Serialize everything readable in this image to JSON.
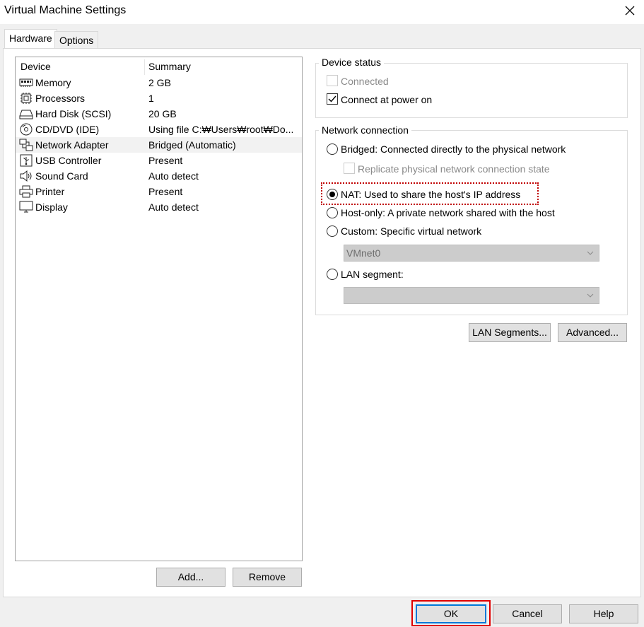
{
  "window": {
    "title": "Virtual Machine Settings"
  },
  "tabs": [
    {
      "label": "Hardware",
      "active": true
    },
    {
      "label": "Options",
      "active": false
    }
  ],
  "device_list": {
    "columns": [
      "Device",
      "Summary"
    ],
    "rows": [
      {
        "name": "Memory",
        "summary": "2 GB",
        "icon": "memory-icon"
      },
      {
        "name": "Processors",
        "summary": "1",
        "icon": "processor-icon"
      },
      {
        "name": "Hard Disk (SCSI)",
        "summary": "20 GB",
        "icon": "hard-disk-icon"
      },
      {
        "name": "CD/DVD (IDE)",
        "summary": "Using file C:₩Users₩root₩Do...",
        "icon": "cd-dvd-icon"
      },
      {
        "name": "Network Adapter",
        "summary": "Bridged (Automatic)",
        "icon": "network-adapter-icon",
        "selected": true
      },
      {
        "name": "USB Controller",
        "summary": "Present",
        "icon": "usb-icon"
      },
      {
        "name": "Sound Card",
        "summary": "Auto detect",
        "icon": "speaker-icon"
      },
      {
        "name": "Printer",
        "summary": "Present",
        "icon": "printer-icon"
      },
      {
        "name": "Display",
        "summary": "Auto detect",
        "icon": "monitor-icon"
      }
    ],
    "add_label": "Add...",
    "remove_label": "Remove"
  },
  "device_status": {
    "title": "Device status",
    "connected_label": "Connected",
    "connected_checked": false,
    "power_on_label": "Connect at power on",
    "power_on_checked": true
  },
  "network": {
    "title": "Network connection",
    "bridged_label": "Bridged: Connected directly to the physical network",
    "replicate_label": "Replicate physical network connection state",
    "nat_label": "NAT: Used to share the host's IP address",
    "hostonly_label": "Host-only: A private network shared with the host",
    "custom_label": "Custom: Specific virtual network",
    "custom_value": "VMnet0",
    "lan_label": "LAN segment:",
    "lan_value": "",
    "selected": "nat"
  },
  "buttons": {
    "lan_segments": "LAN Segments...",
    "advanced": "Advanced...",
    "ok": "OK",
    "cancel": "Cancel",
    "help": "Help"
  },
  "colors": {
    "highlight_red": "#e00000",
    "dotted_red": "#c00000",
    "focus_blue": "#0078d7"
  }
}
